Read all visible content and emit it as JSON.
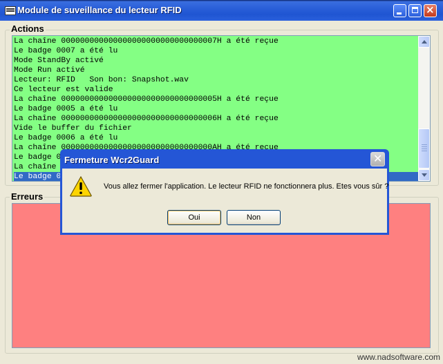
{
  "window": {
    "title": "Module de suveillance du lecteur RFID"
  },
  "actions": {
    "label": "Actions",
    "lines": [
      "La chaîne 000000000000000000000000000000007H a été reçue",
      "Le badge 0007 a été lu",
      "Mode StandBy activé",
      "Mode Run activé",
      "Lecteur: RFID   Son bon: Snapshot.wav",
      "Ce lecteur est valide",
      "La chaîne 000000000000000000000000000000005H a été reçue",
      "Le badge 0005 a été lu",
      "La chaîne 000000000000000000000000000000006H a été reçue",
      "Vide le buffer du fichier",
      "Le badge 0006 a été lu",
      "La chaîne 00000000000000000000000000000000AH a été reçue",
      "Le badge 0",
      "La chaîne",
      "Le badge 0"
    ],
    "selected_index": 14
  },
  "erreurs": {
    "label": "Erreurs"
  },
  "dialog": {
    "title": "Fermeture Wcr2Guard",
    "message": "Vous allez fermer l'application. Le lecteur RFID ne fonctionnera plus. Etes vous sûr ?",
    "ok_label": "Oui",
    "no_label": "Non",
    "icon": "warning-icon"
  },
  "watermark": "www.nadsoftware.com",
  "colors": {
    "actions_bg": "#84ff84",
    "erreurs_bg": "#fe8080",
    "titlebar": "#2456d6",
    "selection": "#316ac5"
  }
}
